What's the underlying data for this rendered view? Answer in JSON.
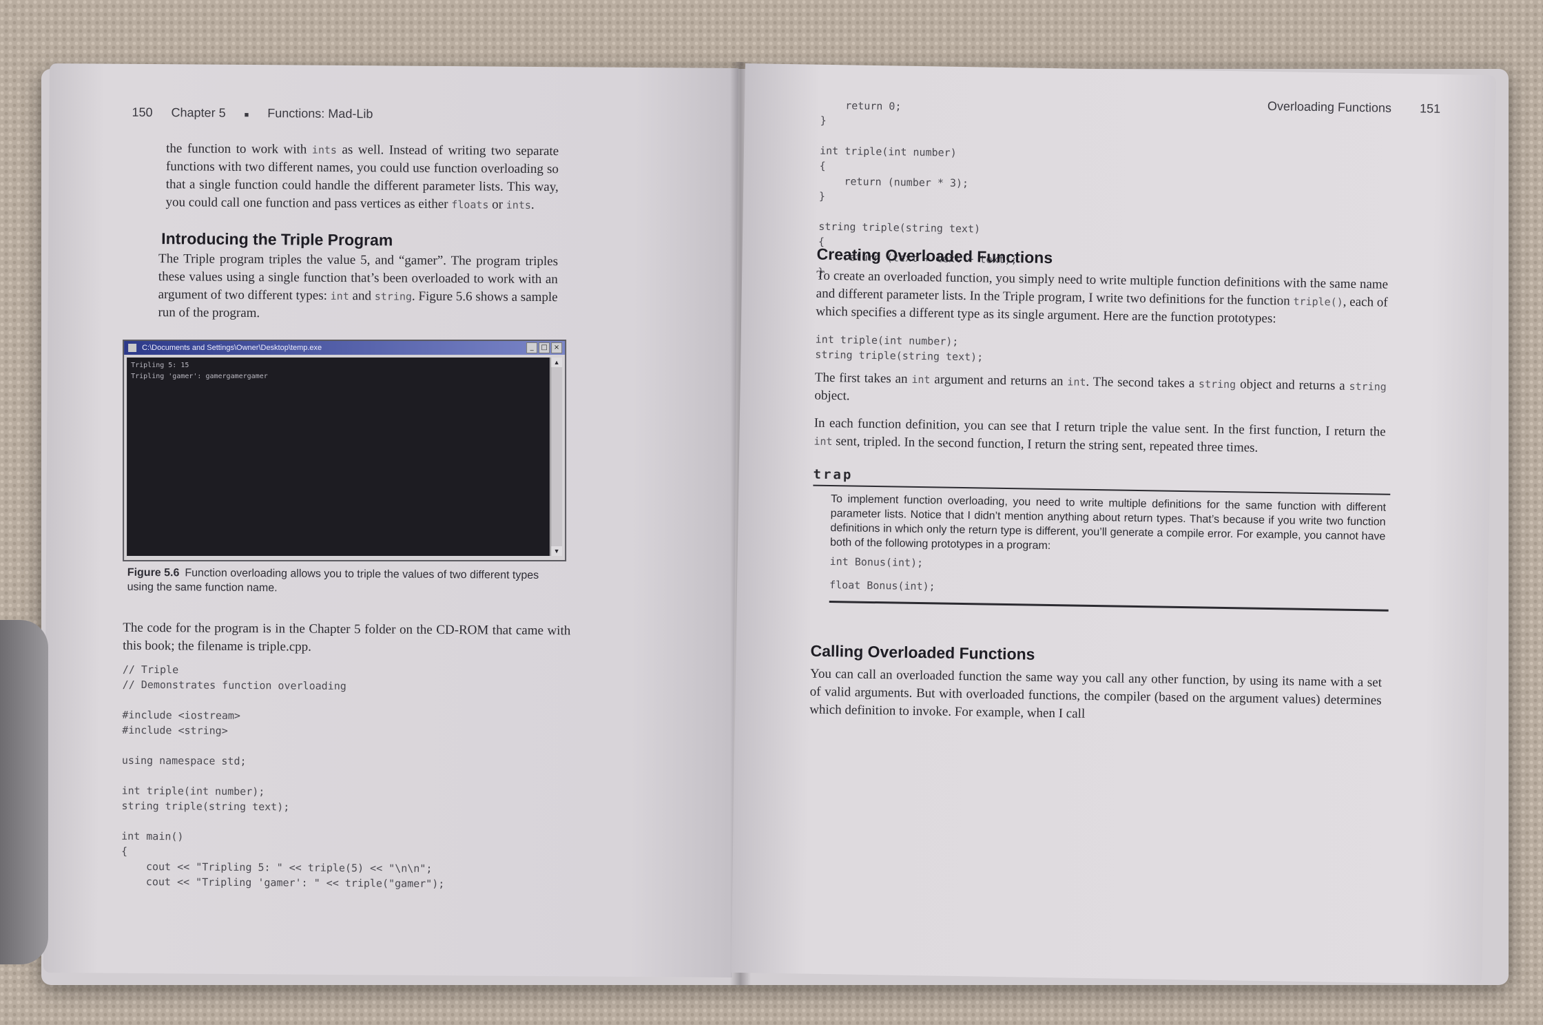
{
  "left_page": {
    "page_number": "150",
    "chapter": "Chapter 5",
    "bullet": "■",
    "section_title": "Functions: Mad-Lib",
    "intro_para": {
      "t1": "the function to work with ",
      "c1": "ints",
      "t2": " as well. Instead of writing two separate functions with two different names, you could use function overloading so that a single function could handle the different parameter lists. This way, you could call one function and pass vertices as either ",
      "c2": "floats",
      "t3": " or ",
      "c3": "ints",
      "t4": "."
    },
    "heading_triple": "Introducing the Triple Program",
    "triple_para": {
      "t1": "The Triple program triples the value 5, and “gamer”. The program triples these values using a single function that’s been overloaded to work with an argument of two different types: ",
      "c1": "int",
      "t2": " and ",
      "c2": "string",
      "t3": ". Figure 5.6 shows a sample run of the program."
    },
    "console": {
      "title": "C:\\Documents and Settings\\Owner\\Desktop\\temp.exe",
      "minimize": "_",
      "maximize": "□",
      "close": "×",
      "scroll_up": "▲",
      "scroll_down": "▼",
      "output_line1": "Tripling 5: 15",
      "output_line2": "Tripling 'gamer': gamergamergamer"
    },
    "figure_label": "Figure 5.6",
    "figure_caption": "Function overloading allows you to triple the values of two different types using the same function name.",
    "code_para": "The code for the program is in the Chapter 5 folder on the CD-ROM that came with this book; the filename is triple.cpp.",
    "code_listing": "// Triple\n// Demonstrates function overloading\n\n#include <iostream>\n#include <string>\n\nusing namespace std;\n\nint triple(int number);\nstring triple(string text);\n\nint main()\n{\n    cout << \"Tripling 5: \" << triple(5) << \"\\n\\n\";\n    cout << \"Tripling 'gamer': \" << triple(\"gamer\");"
  },
  "right_page": {
    "page_number": "151",
    "running_head": "Overloading Functions",
    "code_top": "    return 0;\n}\n\nint triple(int number)\n{\n    return (number * 3);\n}\n\nstring triple(string text)\n{\n    return (text + text + text);\n}",
    "heading_creating": "Creating Overloaded Functions",
    "creating_para": {
      "t1": "To create an overloaded function, you simply need to write multiple function definitions with the same name and different parameter lists. In the Triple program, I write two definitions for the function ",
      "c1": "triple()",
      "t2": ", each of which specifies a different type as its single argument. Here are the function prototypes:"
    },
    "prototypes": "int triple(int number);\nstring triple(string text);",
    "first_para": {
      "t1": "The first takes an ",
      "c1": "int",
      "t2": " argument and returns an ",
      "c2": "int",
      "t3": ". The second takes a ",
      "c3": "string",
      "t4": " object and returns a ",
      "c4": "string",
      "t5": " object."
    },
    "each_para": {
      "t1": "In each function definition, you can see that I return triple the value sent. In the first function, I return the ",
      "c1": "int",
      "t2": " sent, tripled. In the second function, I return the string sent, repeated three times."
    },
    "trap_label": "trap",
    "trap_text": "To implement function overloading, you need to write multiple definitions for the same function with different parameter lists. Notice that I didn’t mention anything about return types. That’s because if you write two function definitions in which only the return type is different, you’ll generate a compile error. For example, you cannot have both of the following prototypes in a program:",
    "trap_code1": "int Bonus(int);",
    "trap_code2": "float Bonus(int);",
    "heading_calling": "Calling Overloaded Functions",
    "calling_para": "You can call an overloaded function the same way you call any other function, by using its name with a set of valid arguments. But with overloaded functions, the compiler (based on the argument values) determines which definition to invoke. For example, when I call"
  }
}
